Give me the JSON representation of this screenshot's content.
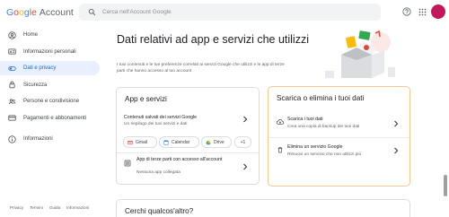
{
  "header": {
    "logo_google": [
      "G",
      "o",
      "o",
      "g",
      "l",
      "e"
    ],
    "logo_account": "Account",
    "search_placeholder": "Cerca nell'Account Google",
    "icons": [
      "search-icon",
      "help-icon",
      "apps-grid-icon",
      "avatar"
    ]
  },
  "sidebar": {
    "items": [
      {
        "label": "Home",
        "icon": "person-circle-icon"
      },
      {
        "label": "Informazioni personali",
        "icon": "id-card-icon"
      },
      {
        "label": "Dati e privacy",
        "icon": "toggle-icon",
        "active": true
      },
      {
        "label": "Sicurezza",
        "icon": "lock-icon"
      },
      {
        "label": "Persone e condivisione",
        "icon": "people-icon"
      },
      {
        "label": "Pagamenti e abbonamenti",
        "icon": "card-icon"
      },
      {
        "label": "Informazioni",
        "icon": "info-icon"
      }
    ],
    "footer": [
      "Privacy",
      "Termini",
      "Guida",
      "Informazioni"
    ]
  },
  "main": {
    "title": "Dati relativi ad app e servizi che utilizzi",
    "intro": "I tuoi contenuti e le tue preferenze correlati ai servizi Google che utilizzi e le app di terze parti che hanno accesso al tuo account"
  },
  "apps_card": {
    "title": "App e servizi",
    "saved_title": "Contenuti salvati dei servizi Google",
    "saved_sub": "Un riepilogo dei tuoi servizi e dati",
    "chips": [
      "Gmail",
      "Calendar",
      "Drive",
      "+1"
    ],
    "third_party_title": "App di terze parti con accesso all'account",
    "third_party_sub": "Nessuna app collegata"
  },
  "download_card": {
    "title": "Scarica o elimina i tuoi dati",
    "download_title": "Scarica i tuoi dati",
    "download_sub": "Crea una copia di backup dei tuoi dati",
    "delete_title": "Elimina un servizio Google",
    "delete_sub": "Rimuovi un servizio che non utilizzi più"
  },
  "bottom_card": {
    "title": "Cerchi qualcos'altro?"
  },
  "colors": {
    "active_bg": "#e8f0fe",
    "active_text": "#1967d2",
    "highlight_border": "#f6c88f",
    "avatar": "#c2185b"
  }
}
